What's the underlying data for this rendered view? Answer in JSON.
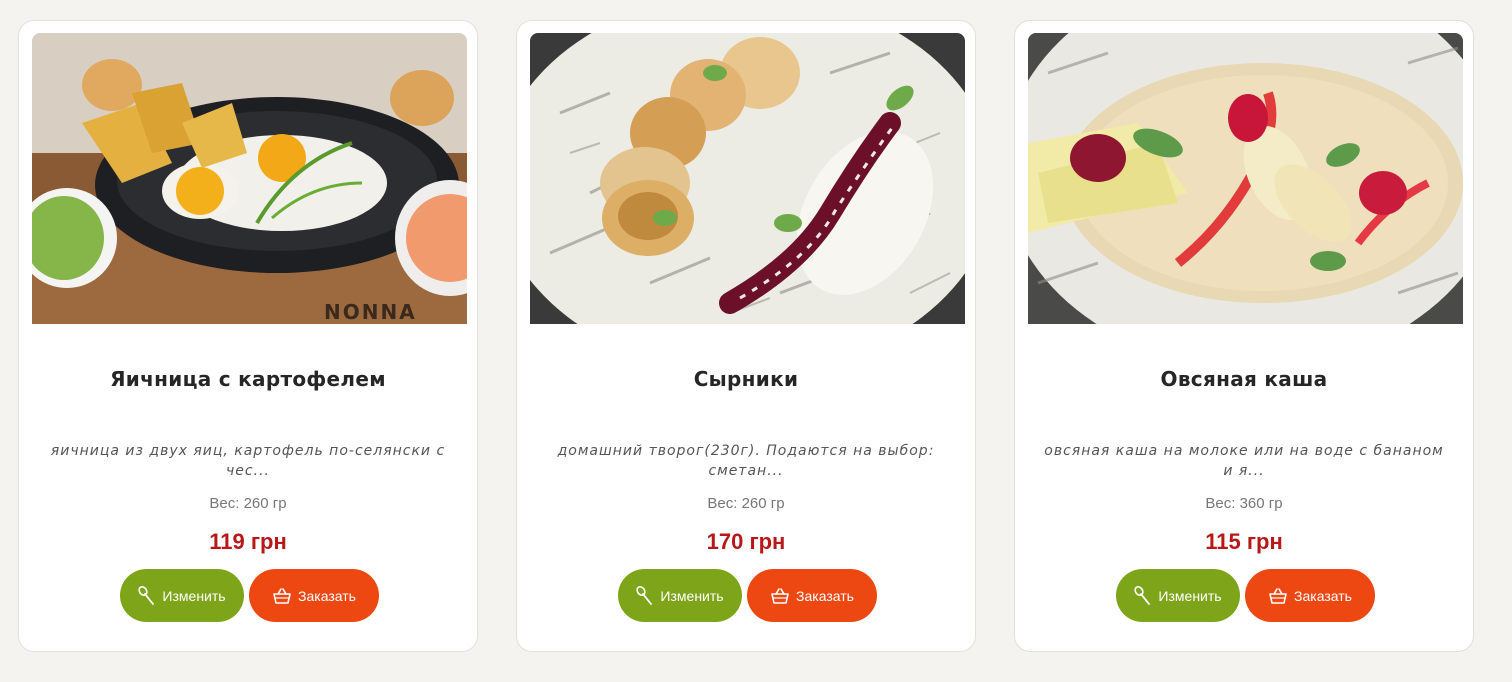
{
  "colors": {
    "accent_green": "#7ea51a",
    "accent_orange": "#ee4812",
    "price_red": "#b81818"
  },
  "icons": {
    "edit": "spoon-icon",
    "order": "basket-icon"
  },
  "cards": [
    {
      "title": "Яичница с картофелем",
      "description": "яичница из двух яиц, картофель по-селянски с чес...",
      "weight": "Вес: 260 гр",
      "price": "119 грн",
      "edit_label": "Изменить",
      "order_label": "Заказать",
      "photo_sign": "NONNA"
    },
    {
      "title": "Сырники",
      "description": "домашний творог(230г). Подаются на выбор: сметан...",
      "weight": "Вес: 260 гр",
      "price": "170 грн",
      "edit_label": "Изменить",
      "order_label": "Заказать"
    },
    {
      "title": "Овсяная каша",
      "description": "овсяная каша на молоке или на воде с бананом и я...",
      "weight": "Вес: 360 гр",
      "price": "115 грн",
      "edit_label": "Изменить",
      "order_label": "Заказать"
    }
  ]
}
